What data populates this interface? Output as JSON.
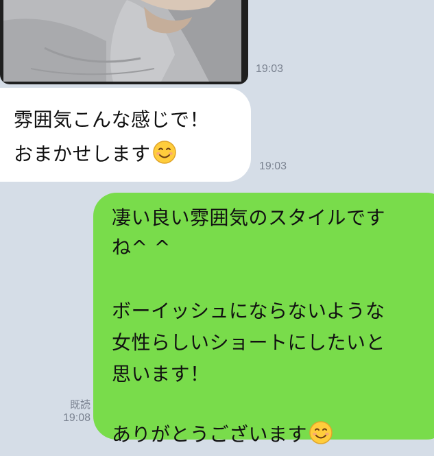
{
  "messages": {
    "photo": {
      "time": "19:03"
    },
    "incoming": {
      "lines": [
        "雰囲気こんな感じで！",
        "おまかせします"
      ],
      "time": "19:03",
      "emoji": "smiling-face-icon"
    },
    "outgoing": {
      "lines": [
        "凄い良い雰囲気のスタイルです",
        "ね^ ^",
        "ボーイッシュにならないような",
        "女性らしいショートにしたいと",
        "思います！",
        "ありがとうございます"
      ],
      "emoji": "smiling-face-icon",
      "read_label": "既読",
      "time": "19:08"
    }
  },
  "colors": {
    "background": "#d5dde7",
    "incoming_bubble": "#ffffff",
    "outgoing_bubble": "#79dc4b",
    "timestamp": "#7a8290"
  }
}
